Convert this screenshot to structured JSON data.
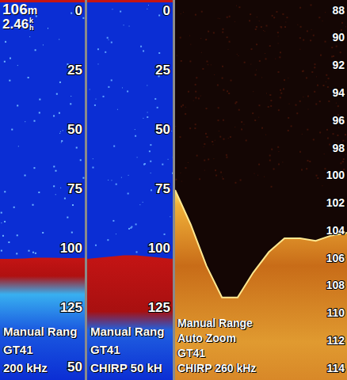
{
  "panels": [
    {
      "kind": "standard",
      "header": {
        "depth": "106",
        "depth_unit": "m",
        "speed": "2.46",
        "speed_unit": "kh"
      },
      "scale": [
        "0",
        "25",
        "50",
        "75",
        "100",
        "125",
        "50"
      ],
      "depth_min": -5,
      "depth_max": 155,
      "bottom": [
        104,
        104,
        103.8,
        103.5,
        103.5,
        103.6,
        103.7,
        103.6
      ],
      "labels": [
        "Manual Rang",
        "GT41",
        "200 kHz"
      ]
    },
    {
      "kind": "chirp-low",
      "scale": [
        "0",
        "25",
        "50",
        "75",
        "100",
        "125"
      ],
      "depth_min": -5,
      "depth_max": 155,
      "bottom": [
        104,
        103.5,
        103,
        102.5,
        102.5,
        103,
        103.5,
        104
      ],
      "labels": [
        "Manual Rang",
        "GT41",
        "CHIRP 50 kH"
      ]
    },
    {
      "kind": "chirp-high",
      "scale": [
        "88",
        "90",
        "92",
        "94",
        "96",
        "98",
        "100",
        "102",
        "104",
        "106",
        "108",
        "110",
        "112",
        "114"
      ],
      "depth_min": 87.2,
      "depth_max": 114.8,
      "bottom": [
        101,
        103.5,
        106.5,
        108.8,
        108.8,
        107,
        105.5,
        104.5,
        104.5,
        104.7,
        104.3,
        104.1
      ],
      "labels": [
        "Manual Range",
        "Auto Zoom",
        "GT41",
        "CHIRP 260 kHz"
      ]
    }
  ]
}
